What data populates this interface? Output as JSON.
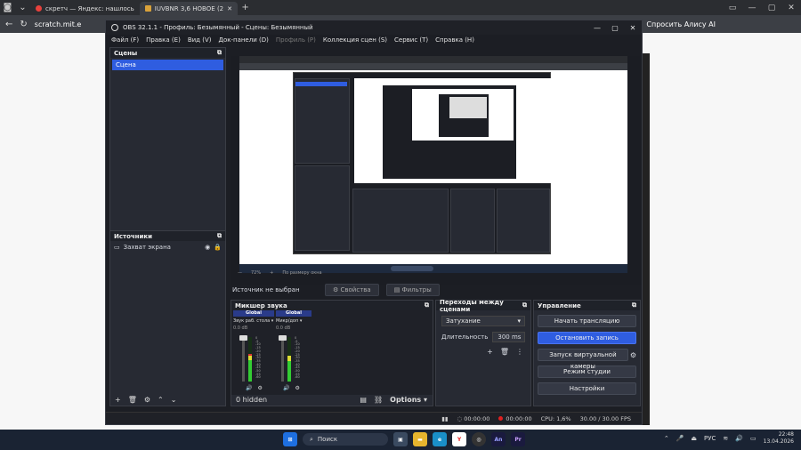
{
  "browser": {
    "tabs": [
      {
        "label": "скретч — Яндекс: нашлось"
      },
      {
        "label": "IUVBNR 3,6 НОВОЕ (2"
      }
    ],
    "new_tab": "+",
    "url": "scratch.mit.e",
    "alice_label": "Спросить Алису AI"
  },
  "obs": {
    "title": "OBS 32.1.1 - Профиль: Безымянный - Сцены: Безымянный",
    "menu": [
      "Файл (F)",
      "Правка (E)",
      "Вид (V)",
      "Док-панели (D)",
      "Профиль (P)",
      "Коллекция сцен (S)",
      "Сервис (T)",
      "Справка (H)"
    ],
    "scenes": {
      "header": "Сцены",
      "items": [
        "Сцена"
      ]
    },
    "sources": {
      "header": "Источники",
      "items": [
        "Захват экрана"
      ]
    },
    "source_bar": {
      "no_source": "Источник не выбран",
      "properties": "Свойства",
      "filters": "Фильтры"
    },
    "zoom": {
      "level": "72%",
      "fit": "По размеру окна"
    },
    "mixer": {
      "header": "Микшер звука",
      "channels": [
        {
          "tag": "Global",
          "name": "Звук раб. стола",
          "db": "0.0 dB"
        },
        {
          "tag": "Global",
          "name": "Микр/доп",
          "db": "0.0 dB"
        }
      ],
      "ticks": [
        "0",
        "-5",
        "-10",
        "-15",
        "-20",
        "-25",
        "-30",
        "-35",
        "-40",
        "-45",
        "-50",
        "-55",
        "-60"
      ],
      "hidden": "0 hidden",
      "options": "Options"
    },
    "transitions": {
      "header": "Переходы между сценами",
      "selected": "Затухание",
      "duration_label": "Длительность",
      "duration_value": "300 ms"
    },
    "controls": {
      "header": "Управление",
      "start_stream": "Начать трансляцию",
      "stop_record": "Остановить запись",
      "virtual_cam": "Запуск виртуальной камеры",
      "studio_mode": "Режим студии",
      "settings": "Настройки"
    },
    "status": {
      "stream_time": "00:00:00",
      "rec_time": "00:00:00",
      "cpu": "CPU: 1,6%",
      "fps": "30.00 / 30.00 FPS"
    }
  },
  "taskbar": {
    "search": "Поиск",
    "lang": "РУС",
    "time": "22:48",
    "date": "13.04.2026",
    "apps": [
      "An",
      "Pr"
    ]
  },
  "colors": {
    "accent": "#2f5de0",
    "obs_bg": "#1c1e24",
    "record": "#e02020"
  }
}
